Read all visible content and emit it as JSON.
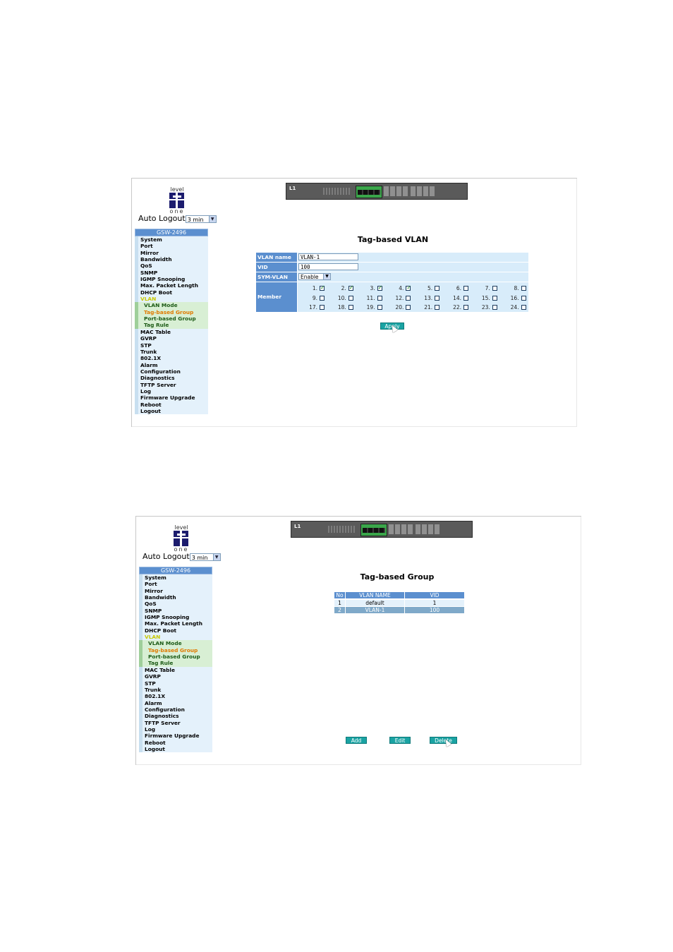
{
  "logo": {
    "top": "level",
    "bottom": "one"
  },
  "auto_logout": {
    "label": "Auto Logout",
    "value": "3 min"
  },
  "device": {
    "brand": "L1"
  },
  "menu": {
    "header": "GSW-2496",
    "items": [
      {
        "label": "System",
        "type": "item"
      },
      {
        "label": "Port",
        "type": "item"
      },
      {
        "label": "Mirror",
        "type": "item"
      },
      {
        "label": "Bandwidth",
        "type": "item"
      },
      {
        "label": "QoS",
        "type": "item"
      },
      {
        "label": "SNMP",
        "type": "item"
      },
      {
        "label": "IGMP Snooping",
        "type": "item"
      },
      {
        "label": "Max. Packet Length",
        "type": "item"
      },
      {
        "label": "DHCP Boot",
        "type": "item"
      },
      {
        "label": "VLAN",
        "type": "vlan"
      },
      {
        "label": "VLAN Mode",
        "type": "sub"
      },
      {
        "label": "Tag-based Group",
        "type": "sub active"
      },
      {
        "label": "Port-based Group",
        "type": "sub"
      },
      {
        "label": "Tag Rule",
        "type": "sub"
      },
      {
        "label": "MAC Table",
        "type": "item"
      },
      {
        "label": "GVRP",
        "type": "item"
      },
      {
        "label": "STP",
        "type": "item"
      },
      {
        "label": "Trunk",
        "type": "item"
      },
      {
        "label": "802.1X",
        "type": "item"
      },
      {
        "label": "Alarm",
        "type": "item"
      },
      {
        "label": "Configuration",
        "type": "item"
      },
      {
        "label": "Diagnostics",
        "type": "item"
      },
      {
        "label": "TFTP Server",
        "type": "item"
      },
      {
        "label": "Log",
        "type": "item"
      },
      {
        "label": "Firmware Upgrade",
        "type": "item"
      },
      {
        "label": "Reboot",
        "type": "item"
      },
      {
        "label": "Logout",
        "type": "item"
      }
    ]
  },
  "vlan_form": {
    "title": "Tag-based VLAN",
    "vlan_name_label": "VLAN name",
    "vlan_name_value": "VLAN-1",
    "vid_label": "VID",
    "vid_value": "100",
    "sym_label": "SYM-VLAN",
    "sym_value": "Enable",
    "member_label": "Member",
    "ports": [
      {
        "label": "1.",
        "checked": true
      },
      {
        "label": "2.",
        "checked": true
      },
      {
        "label": "3.",
        "checked": true
      },
      {
        "label": "4.",
        "checked": true
      },
      {
        "label": "5.",
        "checked": false
      },
      {
        "label": "6.",
        "checked": false
      },
      {
        "label": "7.",
        "checked": false
      },
      {
        "label": "8.",
        "checked": false
      },
      {
        "label": "9.",
        "checked": false
      },
      {
        "label": "10.",
        "checked": false
      },
      {
        "label": "11.",
        "checked": false
      },
      {
        "label": "12.",
        "checked": false
      },
      {
        "label": "13.",
        "checked": false
      },
      {
        "label": "14.",
        "checked": false
      },
      {
        "label": "15.",
        "checked": false
      },
      {
        "label": "16.",
        "checked": false
      },
      {
        "label": "17.",
        "checked": false
      },
      {
        "label": "18.",
        "checked": false
      },
      {
        "label": "19.",
        "checked": false
      },
      {
        "label": "20.",
        "checked": false
      },
      {
        "label": "21.",
        "checked": false
      },
      {
        "label": "22.",
        "checked": false
      },
      {
        "label": "23.",
        "checked": false
      },
      {
        "label": "24.",
        "checked": false
      }
    ],
    "apply_label": "Apply"
  },
  "group": {
    "title": "Tag-based Group",
    "headers": [
      "No",
      "VLAN NAME",
      "VID"
    ],
    "rows": [
      [
        "1",
        "default",
        "1"
      ],
      [
        "2",
        "VLAN-1",
        "100"
      ]
    ],
    "add_label": "Add",
    "edit_label": "Edit",
    "delete_label": "Delete"
  }
}
